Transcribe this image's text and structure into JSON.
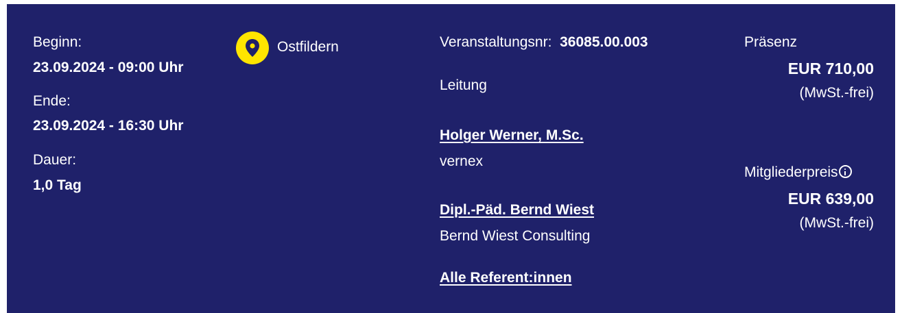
{
  "schedule": {
    "start_label": "Beginn:",
    "start_value": "23.09.2024 - 09:00 Uhr",
    "end_label": "Ende:",
    "end_value": "23.09.2024 - 16:30 Uhr",
    "duration_label": "Dauer:",
    "duration_value": "1,0 Tag"
  },
  "location": {
    "icon": "location-pin-icon",
    "name": "Ostfildern"
  },
  "event": {
    "number_label": "Veranstaltungsnr:",
    "number_value": "36085.00.003",
    "lead_label": "Leitung",
    "speakers": [
      {
        "name": "Holger Werner, M.Sc.",
        "company": "vernex"
      },
      {
        "name": "Dipl.-Päd. Bernd Wiest",
        "company": "Bernd Wiest Consulting"
      }
    ],
    "all_speakers_link": "Alle Referent:innen"
  },
  "pricing": {
    "presence_label": "Präsenz",
    "presence_price": "EUR 710,00",
    "presence_tax": "(MwSt.-frei)",
    "member_label": "Mitgliederpreis",
    "member_info_icon": "info-icon",
    "member_price": "EUR 639,00",
    "member_tax": "(MwSt.-frei)"
  },
  "colors": {
    "panel_background": "#1f216a",
    "pin_accent": "#ffe500",
    "text": "#ffffff"
  }
}
